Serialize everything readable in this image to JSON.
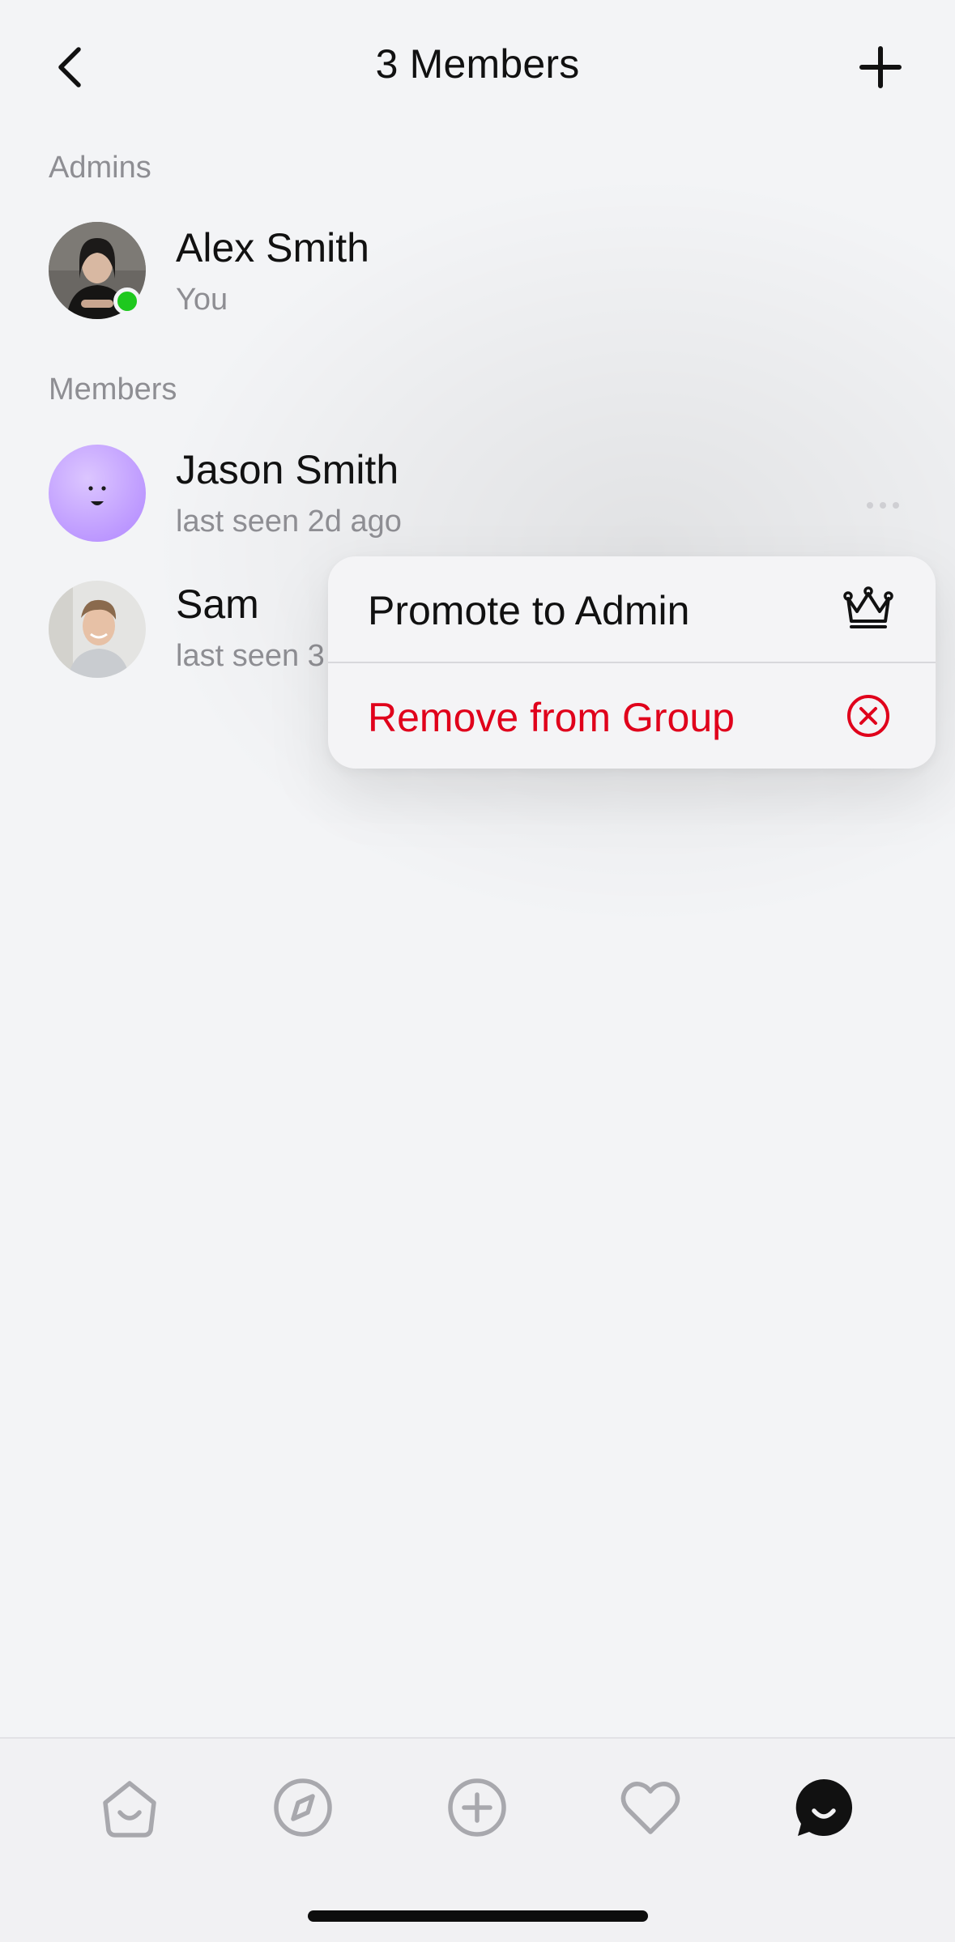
{
  "header": {
    "title": "3 Members",
    "back_icon": "chevron-left-icon",
    "add_icon": "plus-icon"
  },
  "admins": {
    "section_label": "Admins",
    "items": [
      {
        "name": "Alex Smith",
        "subtitle": "You",
        "online": true,
        "avatar": "photo-woman"
      }
    ]
  },
  "members": {
    "section_label": "Members",
    "items": [
      {
        "name": "Jason Smith",
        "subtitle": "last seen 2d ago",
        "avatar": "purple-smiley"
      },
      {
        "name": "Sam",
        "subtitle": "last seen 3",
        "avatar": "photo-man"
      }
    ]
  },
  "context_menu": {
    "items": [
      {
        "label": "Promote to Admin",
        "icon": "crown-icon",
        "color": "#111111"
      },
      {
        "label": "Remove from Group",
        "icon": "x-circle-icon",
        "color": "#e0001b"
      }
    ]
  },
  "tabbar": {
    "tabs": [
      {
        "icon": "home-icon",
        "active": false
      },
      {
        "icon": "compass-icon",
        "active": false
      },
      {
        "icon": "plus-circle-icon",
        "active": false
      },
      {
        "icon": "heart-icon",
        "active": false
      },
      {
        "icon": "chat-icon",
        "active": true
      }
    ]
  },
  "colors": {
    "background": "#f3f4f6",
    "destructive": "#e0001b",
    "online": "#1ec81e",
    "secondary_text": "#8e8e93"
  }
}
